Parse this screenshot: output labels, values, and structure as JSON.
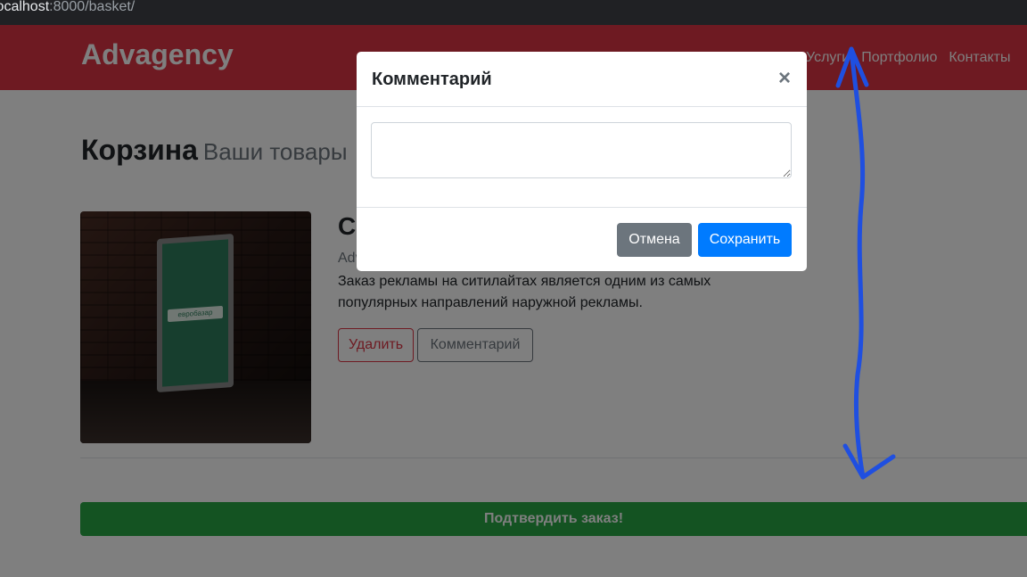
{
  "browser": {
    "url_host": "localhost",
    "url_rest": ":8000/basket/"
  },
  "navbar": {
    "brand": "Advagency",
    "links": [
      "Услуги",
      "Портфолио",
      "Контакты"
    ]
  },
  "heading": {
    "title": "Корзина",
    "subtitle": "Ваши товары"
  },
  "product": {
    "title_partial": "Си",
    "brand_partial": "Adv",
    "description": "Заказ рекламы на ситилайтах является одним из самых популярных направлений наружной рекламы.",
    "sign_text": "евробазар",
    "delete_label": "Удалить",
    "comment_label": "Комментарий"
  },
  "confirm_label": "Подтвердить заказ!",
  "modal": {
    "title": "Комментарий",
    "close_symbol": "×",
    "textarea_value": "",
    "cancel_label": "Отмена",
    "save_label": "Сохранить"
  },
  "colors": {
    "navbar": "#dc3545",
    "success": "#28a745",
    "primary": "#007bff",
    "secondary": "#6c757d",
    "annotation": "#1f4fe0"
  }
}
